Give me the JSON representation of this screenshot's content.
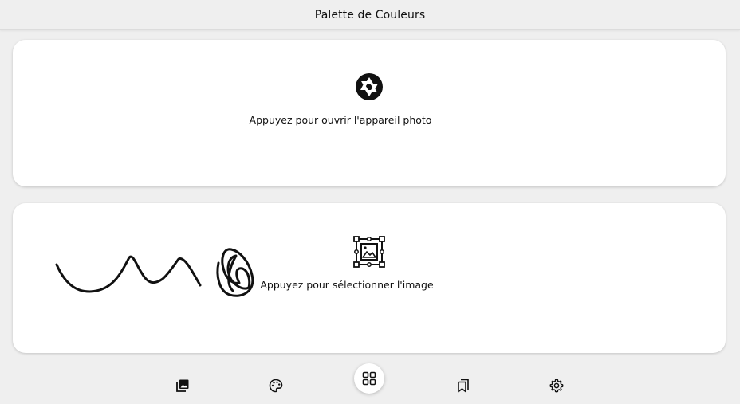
{
  "header": {
    "title": "Palette de Couleurs"
  },
  "camera_card": {
    "icon": "camera-shutter-icon",
    "label": "Appuyez pour ouvrir l'appareil photo"
  },
  "gallery_card": {
    "icon": "image-select-icon",
    "label": "Appuyez pour sélectionner l'image"
  },
  "bottom_nav": {
    "items": [
      {
        "icon": "photo-library-icon"
      },
      {
        "icon": "palette-icon"
      },
      {
        "icon": "grid-icon",
        "active": true
      },
      {
        "icon": "bookmarks-icon"
      },
      {
        "icon": "settings-icon"
      }
    ]
  }
}
